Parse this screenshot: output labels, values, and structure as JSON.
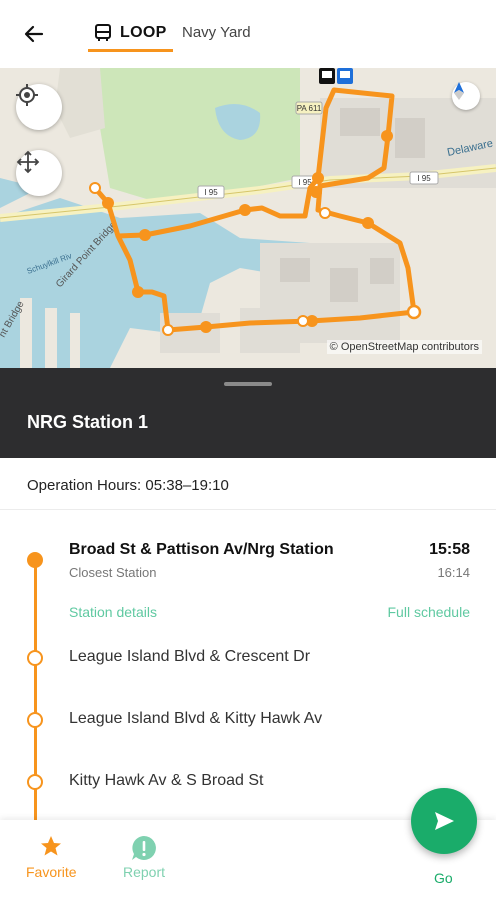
{
  "header": {
    "route_name": "LOOP",
    "route_subtitle": "Navy Yard"
  },
  "map": {
    "attribution": "© OpenStreetMap contributors",
    "labels": {
      "highway1": "I 95",
      "highway2": "I 95",
      "highway3": "I 95",
      "pa": "PA 611",
      "delaware": "Delaware",
      "girard": "Girard Point Bridge",
      "schuylkill": "Schuylkill Riv",
      "bridge": "nt Bridge"
    }
  },
  "station": {
    "title": "NRG Station 1",
    "hours": "Operation Hours: 05:38–19:10"
  },
  "stops": [
    {
      "name": "Broad St & Pattison Av/Nrg Station",
      "note": "Closest Station",
      "time": "15:58",
      "next_time": "16:14",
      "details_link": "Station details",
      "schedule_link": "Full schedule"
    },
    {
      "name": "League Island Blvd & Crescent Dr"
    },
    {
      "name": "League Island Blvd & Kitty Hawk Av"
    },
    {
      "name": "Kitty Hawk Av & S Broad St"
    }
  ],
  "nav": {
    "favorite": "Favorite",
    "report": "Report",
    "go": "Go"
  },
  "colors": {
    "accent": "#f7941d",
    "green": "#1aac6a",
    "teal_link": "#5fc9a1",
    "dark_header": "#2d2d2f"
  },
  "icons": [
    "back-arrow-icon",
    "bus-icon",
    "location-target-icon",
    "move-arrows-icon",
    "compass-icon",
    "star-icon",
    "report-bubble-icon",
    "send-arrow-icon"
  ]
}
